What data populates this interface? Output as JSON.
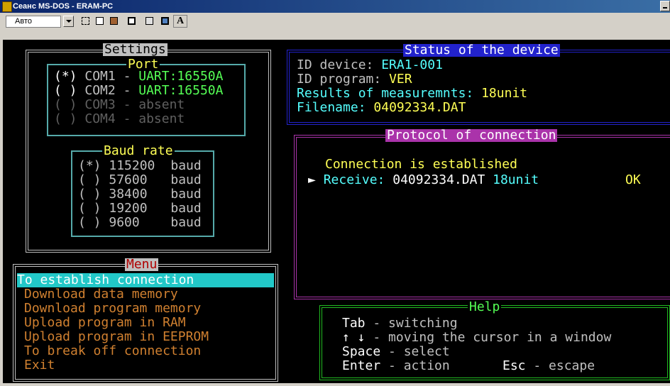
{
  "window": {
    "title": "Сеанс MS-DOS - ERAM-PC"
  },
  "toolbar": {
    "font_value": "Авто",
    "font_button": "A"
  },
  "settings": {
    "title": "Settings",
    "port": {
      "title": "Port",
      "items": [
        {
          "mark": "(*)",
          "name": "COM1",
          "dash": "-",
          "value": "UART:16550A"
        },
        {
          "mark": "( )",
          "name": "COM2",
          "dash": "-",
          "value": "UART:16550A"
        },
        {
          "mark": "( )",
          "name": "COM3",
          "dash": "-",
          "value": "absent"
        },
        {
          "mark": "( )",
          "name": "COM4",
          "dash": "-",
          "value": "absent"
        }
      ]
    },
    "baud": {
      "title": "Baud rate",
      "items": [
        {
          "mark": "(*)",
          "value": "115200",
          "unit": "baud"
        },
        {
          "mark": "( )",
          "value": "57600",
          "unit": "baud"
        },
        {
          "mark": "( )",
          "value": "38400",
          "unit": "baud"
        },
        {
          "mark": "( )",
          "value": "19200",
          "unit": "baud"
        },
        {
          "mark": "( )",
          "value": "9600",
          "unit": "baud"
        }
      ]
    }
  },
  "status": {
    "title": "Status of the device",
    "id_device_label": "ID device:",
    "id_device_value": "ERA1-001",
    "id_program_label": "ID program:",
    "id_program_value": "VER",
    "results_label": "Results of measuremnts:",
    "results_value": "18unit",
    "filename_label": "Filename:",
    "filename_value": "04092334.DAT"
  },
  "protocol": {
    "title": "Protocol of connection",
    "line1": "Connection is established",
    "receive_label": "Receive:",
    "receive_file": "04092334.DAT",
    "receive_units": "18unit",
    "receive_status": "OK"
  },
  "menu": {
    "title": "Menu",
    "items": [
      "To establish connection",
      "Download data memory",
      "Download program memory",
      "Upload program in RAM",
      "Upload program in EEPROM",
      "To break off connection",
      "Exit"
    ]
  },
  "help": {
    "title": "Help",
    "tab_key": "Tab",
    "tab_desc": "- switching",
    "arrows_key": "↑ ↓",
    "arrows_desc": "- moving the cursor in a window",
    "space_key": "Space",
    "space_desc": "- select",
    "enter_key": "Enter",
    "enter_desc": "- action",
    "esc_key": "Esc",
    "esc_desc": "- escape"
  },
  "colors": {
    "background": "#000000",
    "settings_border": "#c0c0c0",
    "port_border": "#55aaaa",
    "status_border": "#2222cc",
    "protocol_border": "#aa33aa",
    "help_border": "#22bb22",
    "menu_highlight": "#22c8c8",
    "menu_text": "#d08030"
  }
}
